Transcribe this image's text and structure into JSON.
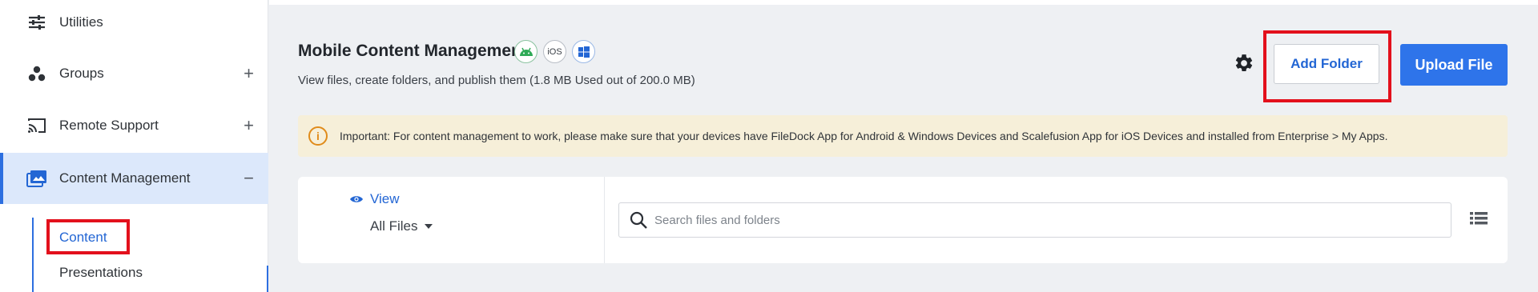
{
  "sidebar": {
    "items": [
      {
        "label": "Utilities",
        "toggle": ""
      },
      {
        "label": "Groups",
        "toggle": "+"
      },
      {
        "label": "Remote Support",
        "toggle": "+"
      },
      {
        "label": "Content Management",
        "toggle": "−"
      }
    ],
    "sub_items": [
      {
        "label": "Content"
      },
      {
        "label": "Presentations"
      }
    ]
  },
  "header": {
    "title": "Mobile Content Management",
    "platforms": [
      "android-icon",
      "iOS",
      "windows-icon"
    ],
    "subtitle": "View files, create folders, and publish them (1.8 MB Used out of 200.0 MB)",
    "add_folder_label": "Add Folder",
    "upload_file_label": "Upload File"
  },
  "notice": {
    "icon": "info-icon",
    "text": "Important: For content management to work, please make sure that your devices have FileDock App for Android & Windows Devices and Scalefusion App for iOS Devices and installed from Enterprise > My Apps."
  },
  "filters": {
    "view_label": "View",
    "filter_value": "All Files"
  },
  "search": {
    "placeholder": "Search files and folders",
    "value": ""
  },
  "colors": {
    "accent": "#2e74ea",
    "highlight_border": "#e3101c",
    "notice_bg": "#f6efd9",
    "active_bg": "#dce8fb"
  }
}
